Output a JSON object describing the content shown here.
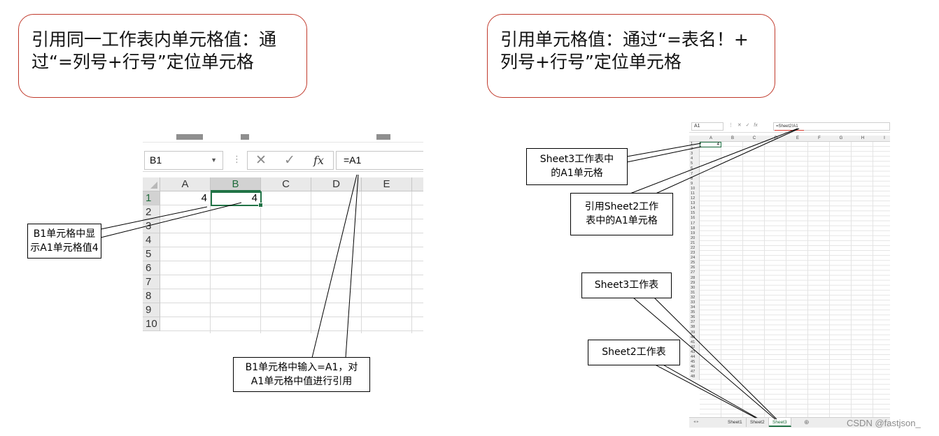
{
  "bubbles": {
    "left": {
      "line1": "引用同一工作表内单元格值：通",
      "line2": "过“=列号+行号”定位单元格"
    },
    "right": {
      "line1": "引用单元格值：通过“=表名！+",
      "line2": "列号+行号”定位单元格"
    }
  },
  "left_excel": {
    "name_box": "B1",
    "formula": "=A1",
    "columns": [
      "A",
      "B",
      "C",
      "D",
      "E"
    ],
    "selected_column": "B",
    "rows": [
      "1",
      "2",
      "3",
      "4",
      "5",
      "6",
      "7",
      "8",
      "9",
      "10"
    ],
    "cell_A1": "4",
    "cell_B1": "4"
  },
  "left_callouts": {
    "b1_display": {
      "line1": "B1单元格中显",
      "line2": "示A1单元格值4"
    },
    "b1_input": {
      "line1": "B1单元格中输入=A1，对",
      "line2": "A1单元格中值进行引用"
    }
  },
  "right_excel": {
    "name_box": "A1",
    "formula": "=Sheet2!A1",
    "columns": [
      "A",
      "B",
      "C",
      "D",
      "E",
      "F",
      "G",
      "H",
      "I"
    ],
    "rows": [
      "1",
      "2",
      "3",
      "4",
      "5",
      "6",
      "7",
      "8",
      "9",
      "10",
      "11",
      "12",
      "13",
      "14",
      "15",
      "16",
      "17",
      "18",
      "19",
      "20",
      "21",
      "22",
      "23",
      "24",
      "25",
      "26",
      "27",
      "28",
      "29",
      "30",
      "31",
      "32",
      "33",
      "34",
      "35",
      "36",
      "37",
      "38",
      "39",
      "40",
      "41",
      "42",
      "43",
      "44",
      "45",
      "46",
      "47",
      "48"
    ],
    "cell_A1": "4",
    "sheet_tabs": [
      "Sheet1",
      "Sheet2",
      "Sheet3"
    ],
    "active_tab": "Sheet3",
    "add_sheet": "⊕"
  },
  "right_callouts": {
    "sheet3_a1": {
      "line1": "Sheet3工作表中",
      "line2": "的A1单元格"
    },
    "ref_sheet2": {
      "line1": "引用Sheet2工作",
      "line2": "表中的A1单元格"
    },
    "sheet3": "Sheet3工作表",
    "sheet2": "Sheet2工作表"
  },
  "watermark": "CSDN @fastjson_"
}
